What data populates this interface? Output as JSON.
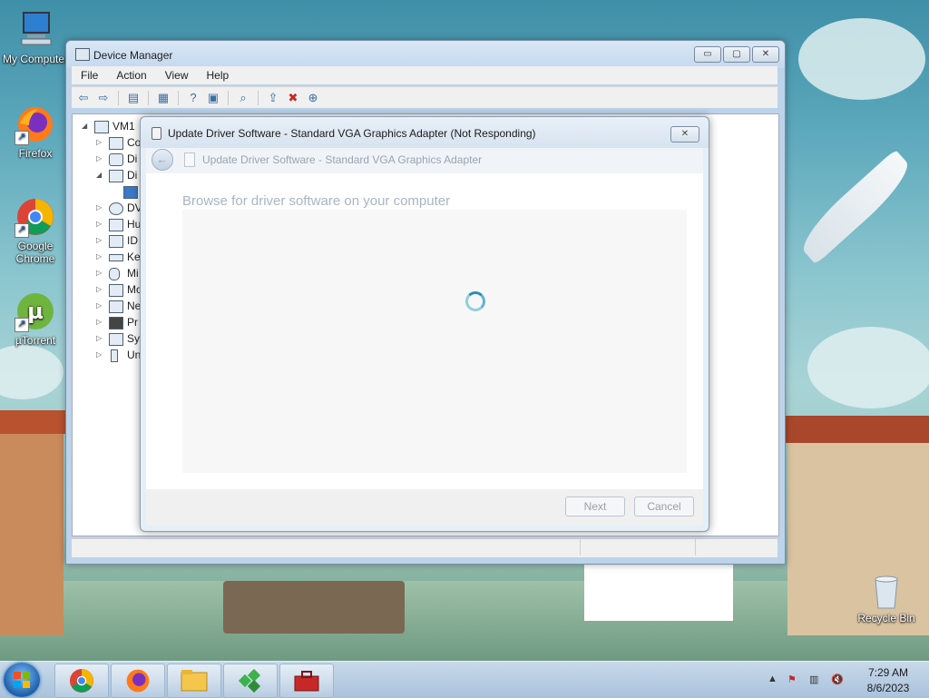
{
  "desktop": {
    "icons": [
      {
        "label": "My Computer",
        "icon": "computer-icon"
      },
      {
        "label": "Firefox",
        "icon": "firefox-icon"
      },
      {
        "label": "Google Chrome",
        "icon": "chrome-icon"
      },
      {
        "label": "µTorrent",
        "icon": "utorrent-icon"
      },
      {
        "label": "Recycle Bin",
        "icon": "recycle-bin-icon"
      }
    ]
  },
  "device_manager": {
    "title": "Device Manager",
    "window_buttons": {
      "minimize": "▭",
      "restore": "▢",
      "close": "✕"
    },
    "menu": [
      "File",
      "Action",
      "View",
      "Help"
    ],
    "toolbar_icons": [
      "back-arrow-icon",
      "forward-arrow-icon",
      "show-hide-tree-icon",
      "properties-icon",
      "help-icon",
      "device-view-icon",
      "scan-hardware-icon",
      "update-driver-icon",
      "uninstall-device-icon",
      "add-legacy-icon"
    ],
    "tree": {
      "root": "VM1",
      "items": [
        "Co",
        "Di",
        "Di",
        "DV",
        "Hu",
        "ID",
        "Ke",
        "Mi",
        "Mo",
        "Ne",
        "Pr",
        "Sy",
        "Un"
      ]
    }
  },
  "update_dialog": {
    "title": "Update Driver Software - Standard VGA Graphics Adapter (Not Responding)",
    "close_glyph": "✕",
    "subtitle": "Update Driver Software - Standard VGA Graphics Adapter",
    "heading": "Browse for driver software on your computer",
    "next_label": "Next",
    "cancel_label": "Cancel"
  },
  "taskbar": {
    "apps": [
      "chrome-icon",
      "firefox-icon",
      "file-explorer-icon",
      "network-app-icon",
      "toolbox-app-icon"
    ],
    "tray_icons": [
      "show-hidden-icons-icon",
      "action-center-icon",
      "network-icon",
      "volume-muted-icon"
    ],
    "show_hidden_glyph": "▲",
    "time": "7:29 AM",
    "date": "8/6/2023"
  }
}
